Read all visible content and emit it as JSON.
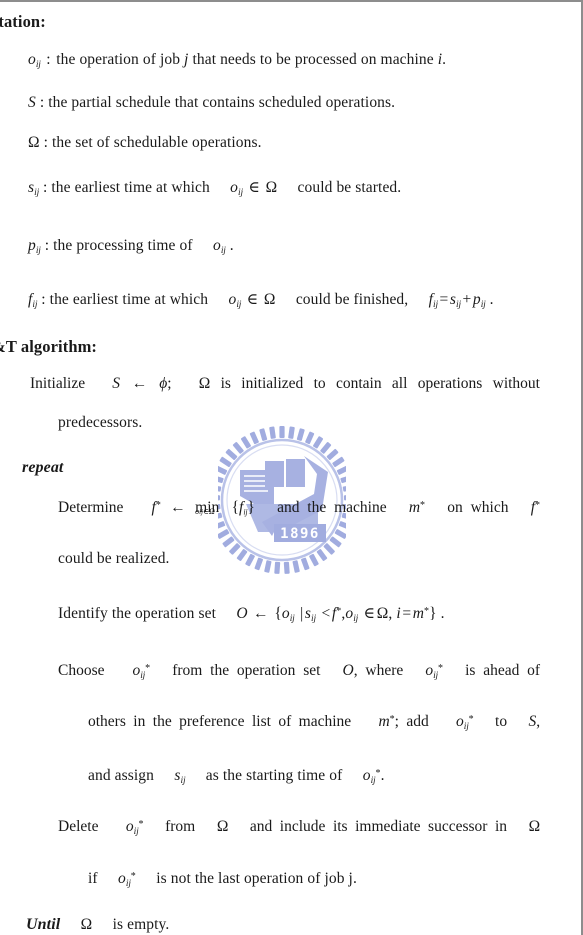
{
  "document": {
    "type": "scanned-thesis-page",
    "watermark": {
      "name": "university-seal",
      "year_text": "1896",
      "color": "#9aa6dd"
    },
    "sections": [
      {
        "id": "notation",
        "heading": "otation:"
      },
      {
        "id": "algorithm",
        "heading": "&T algorithm:"
      }
    ]
  },
  "notation": {
    "heading": "otation:",
    "items": [
      {
        "symbol": "o",
        "sub": "ij",
        "text": "the operation of job j that needs to be processed on machine i."
      },
      {
        "symbol": "S",
        "sub": "",
        "text": "the partial schedule that contains scheduled operations."
      },
      {
        "symbol": "Ω",
        "sub": "",
        "text": "the set of schedulable operations."
      },
      {
        "symbol": "s",
        "sub": "ij",
        "text": "the earliest time at which  oᵢⱼ ∈ Ω  could be started."
      },
      {
        "symbol": "p",
        "sub": "ij",
        "text": "the processing time of  oᵢⱼ ."
      },
      {
        "symbol": "f",
        "sub": "ij",
        "text": "the earliest time at which  oᵢⱼ ∈ Ω  could be finished,  fᵢⱼ = sᵢⱼ + pᵢⱼ ."
      }
    ],
    "frag": {
      "the_operation_of_job": "the operation of job",
      "j_that_needs": "that needs to be processed on machine",
      "i_period": ".",
      "colon": ":",
      "partial_schedule": ": the partial schedule that contains scheduled operations.",
      "set_of_schedulable": ": the set of schedulable operations.",
      "earliest_time_at_which": ": the earliest time at which",
      "could_be_started": "could be started.",
      "processing_time_of": ": the processing time of",
      "period": ".",
      "could_be_finished": "could be finished,"
    }
  },
  "algorithm": {
    "heading": "&T algorithm:",
    "lines": {
      "initialize_1a": "Initialize",
      "initialize_1b": "is initialized to contain all operations without",
      "initialize_2": "predecessors.",
      "repeat": "repeat",
      "determine_a": "Determine",
      "determine_b": "and the machine",
      "determine_c": "on which",
      "determine_2": "could be realized.",
      "identify_a": "Identify the operation set",
      "identify_end": ".",
      "choose_a": "Choose",
      "choose_b": "from the operation set",
      "choose_c": ", where",
      "choose_d": "is ahead of",
      "choose_2a": "others in the preference list of machine",
      "choose_2b": "; add",
      "choose_2c": "to",
      "choose_2d": ",",
      "choose_3a": "and assign",
      "choose_3b": "as the starting time of",
      "choose_3c": ".",
      "delete_a": "Delete",
      "delete_b": "from",
      "delete_c": "and include its immediate successor in",
      "delete_2a": "if",
      "delete_2b": "is not the last operation of job j.",
      "until_a": "Until",
      "until_b": "is empty."
    },
    "symbols": {
      "S": "S",
      "omega": "Ω",
      "phi": "ϕ",
      "arrow": "←",
      "min": "min",
      "in": "∈",
      "lt": "<",
      "eq": "=",
      "plus": "+",
      "star": "*",
      "o": "o",
      "f": "f",
      "m": "m",
      "s": "s",
      "p": "p",
      "O": "O",
      "i": "i",
      "j": "j",
      "ij": "ij",
      "lbrace": "{",
      "rbrace": "}",
      "mid": "|",
      "comma": ",",
      "semicolon": ";"
    }
  }
}
